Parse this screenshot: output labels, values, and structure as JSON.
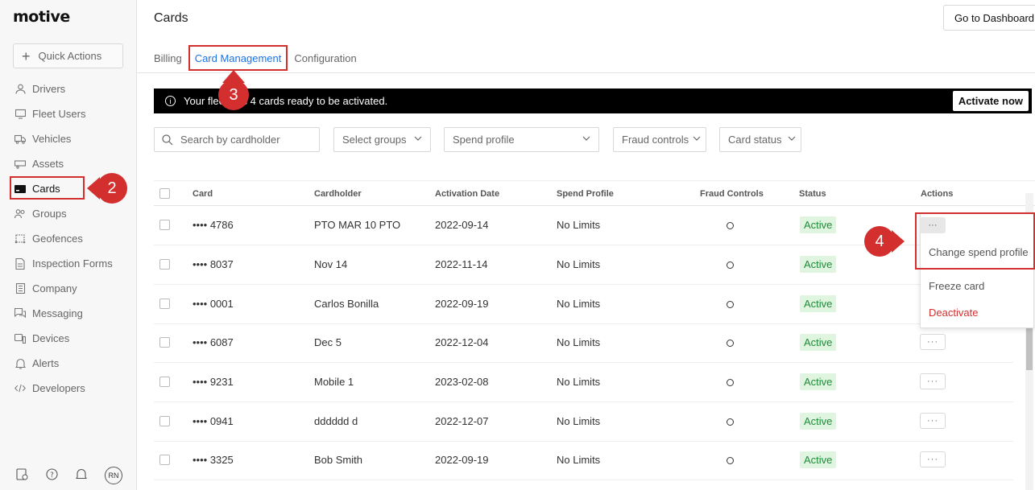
{
  "app": {
    "logo": "motive",
    "quick_actions": "Quick Actions"
  },
  "sidebar": {
    "items": [
      {
        "label": "Drivers",
        "icon": "user-icon"
      },
      {
        "label": "Fleet Users",
        "icon": "monitor-icon"
      },
      {
        "label": "Vehicles",
        "icon": "truck-icon"
      },
      {
        "label": "Assets",
        "icon": "trailer-icon"
      },
      {
        "label": "Cards",
        "icon": "card-icon"
      },
      {
        "label": "Groups",
        "icon": "users-icon"
      },
      {
        "label": "Geofences",
        "icon": "geofence-icon"
      },
      {
        "label": "Inspection Forms",
        "icon": "document-icon"
      },
      {
        "label": "Company",
        "icon": "building-icon"
      },
      {
        "label": "Messaging",
        "icon": "chat-icon"
      },
      {
        "label": "Devices",
        "icon": "device-icon"
      },
      {
        "label": "Alerts",
        "icon": "bell-icon"
      },
      {
        "label": "Developers",
        "icon": "code-icon"
      }
    ],
    "footer": {
      "avatar": "RN"
    }
  },
  "header": {
    "title": "Cards",
    "dashboard_button": "Go to Dashboard"
  },
  "tabs": [
    "Billing",
    "Card Management",
    "Configuration"
  ],
  "banner": {
    "text": "Your fleet has 4 cards ready to be activated.",
    "action": "Activate now"
  },
  "filters": {
    "search_placeholder": "Search by cardholder",
    "groups": "Select groups",
    "spend_profile": "Spend profile",
    "fraud_controls": "Fraud controls",
    "card_status": "Card status"
  },
  "table": {
    "columns": [
      "Card",
      "Cardholder",
      "Activation Date",
      "Spend Profile",
      "Fraud Controls",
      "Status",
      "Actions"
    ],
    "rows": [
      {
        "card": "•••• 4786",
        "cardholder": "PTO MAR 10 PTO",
        "date": "2022-09-14",
        "profile": "No Limits",
        "status": "Active"
      },
      {
        "card": "•••• 8037",
        "cardholder": "Nov 14",
        "date": "2022-11-14",
        "profile": "No Limits",
        "status": "Active"
      },
      {
        "card": "•••• 0001",
        "cardholder": "Carlos Bonilla",
        "date": "2022-09-19",
        "profile": "No Limits",
        "status": "Active"
      },
      {
        "card": "•••• 6087",
        "cardholder": "Dec 5",
        "date": "2022-12-04",
        "profile": "No Limits",
        "status": "Active"
      },
      {
        "card": "•••• 9231",
        "cardholder": "Mobile 1",
        "date": "2023-02-08",
        "profile": "No Limits",
        "status": "Active"
      },
      {
        "card": "•••• 0941",
        "cardholder": "dddddd d",
        "date": "2022-12-07",
        "profile": "No Limits",
        "status": "Active"
      },
      {
        "card": "•••• 3325",
        "cardholder": "Bob Smith",
        "date": "2022-09-19",
        "profile": "No Limits",
        "status": "Active"
      }
    ]
  },
  "actions_menu": {
    "dots": "···",
    "items": [
      "Change spend profile",
      "Freeze card",
      "Deactivate"
    ]
  },
  "markers": [
    "2",
    "3",
    "4"
  ],
  "colors": {
    "accent": "#1a73e8",
    "highlight": "#d32f2f",
    "active_bg": "#dff5df",
    "active_text": "#1e8c3a"
  }
}
